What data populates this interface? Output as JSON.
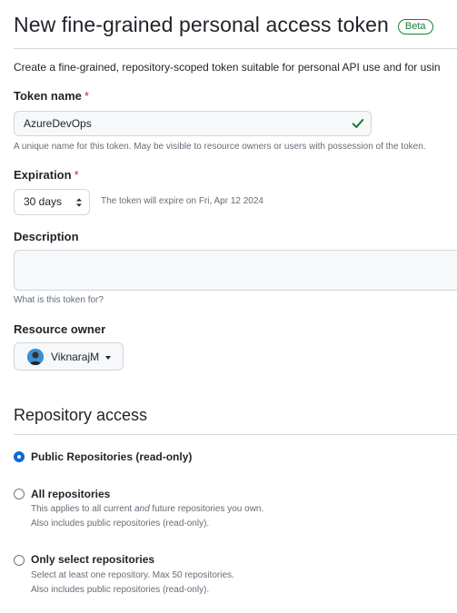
{
  "header": {
    "title": "New fine-grained personal access token",
    "badge": "Beta",
    "intro": "Create a fine-grained, repository-scoped token suitable for personal API use and for usin"
  },
  "token_name": {
    "label": "Token name",
    "required_mark": "*",
    "value": "AzureDevOps",
    "help": "A unique name for this token. May be visible to resource owners or users with possession of the token."
  },
  "expiration": {
    "label": "Expiration",
    "required_mark": "*",
    "selected": "30 days",
    "note": "The token will expire on Fri, Apr 12 2024"
  },
  "description": {
    "label": "Description",
    "value": "",
    "help": "What is this token for?"
  },
  "resource_owner": {
    "label": "Resource owner",
    "selected": "ViknarajM"
  },
  "repository_access": {
    "title": "Repository access",
    "options": [
      {
        "label": "Public Repositories (read-only)",
        "checked": true,
        "lines": []
      },
      {
        "label": "All repositories",
        "checked": false,
        "lines": [
          {
            "pre": "This applies to all current ",
            "em": "and",
            "post": " future repositories you own."
          },
          {
            "text": "Also includes public repositories (read-only)."
          }
        ]
      },
      {
        "label": "Only select repositories",
        "checked": false,
        "lines": [
          {
            "text": "Select at least one repository. Max 50 repositories."
          },
          {
            "text": "Also includes public repositories (read-only)."
          }
        ]
      }
    ]
  },
  "colors": {
    "accent": "#0969da",
    "success": "#1a7f37",
    "danger": "#cf222e",
    "muted": "#656d76",
    "border": "#d0d7de"
  },
  "icons": {
    "token_valid": "check-icon",
    "select": "select-arrows-icon",
    "owner_dropdown": "caret-down-icon"
  }
}
